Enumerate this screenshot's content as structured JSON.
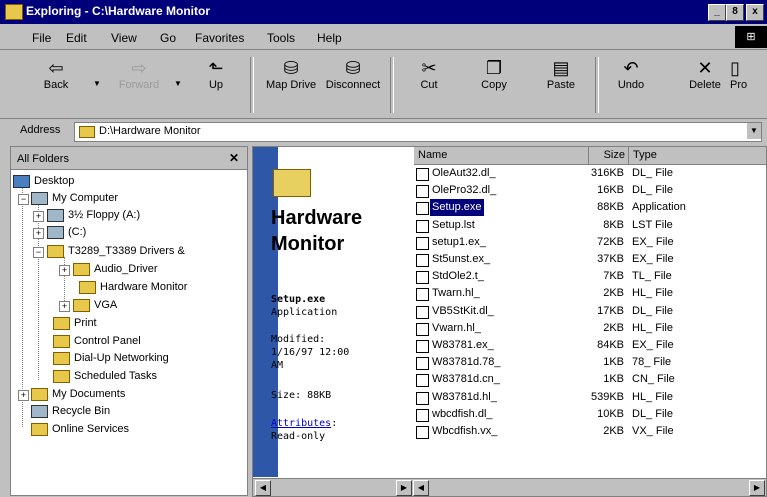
{
  "window": {
    "title": "Exploring - C:\\Hardware Monitor",
    "controls": [
      "_",
      "8",
      "x"
    ]
  },
  "menu": [
    "File",
    "Edit",
    "View",
    "Go",
    "Favorites",
    "Tools",
    "Help"
  ],
  "toolbar": {
    "back": "Back",
    "forward": "Forward",
    "up": "Up",
    "map_drive": "Map Drive",
    "disconnect": "Disconnect",
    "cut": "Cut",
    "copy": "Copy",
    "paste": "Paste",
    "undo": "Undo",
    "delete": "Delete",
    "properties": "Pro"
  },
  "address": {
    "label": "Address",
    "value": "D:\\Hardware Monitor"
  },
  "folders": {
    "header": "All Folders",
    "close": "✕",
    "items": [
      {
        "label": "Desktop"
      },
      {
        "label": "My Computer"
      },
      {
        "label": "3½ Floppy (A:)"
      },
      {
        "label": "(C:)"
      },
      {
        "label": "T3289_T3389 Drivers &"
      },
      {
        "label": "Audio_Driver"
      },
      {
        "label": "Hardware Monitor"
      },
      {
        "label": "VGA"
      },
      {
        "label": "Print"
      },
      {
        "label": "Control Panel"
      },
      {
        "label": "Dial-Up Networking"
      },
      {
        "label": "Scheduled Tasks"
      },
      {
        "label": "My Documents"
      },
      {
        "label": "Recycle Bin"
      },
      {
        "label": "Online Services"
      }
    ]
  },
  "webview": {
    "title_line1": "Hardware",
    "title_line2": "Monitor",
    "selected_name": "Setup.exe",
    "selected_type": "Application",
    "modified_label": "Modified:",
    "modified_value": "1/16/97 12:00",
    "modified_ampm": "AM",
    "size_text": "Size: 88KB",
    "attributes_label": "Attributes",
    "attributes_value": "Read-only"
  },
  "list": {
    "columns": [
      "Name",
      "Size",
      "Type"
    ],
    "rows": [
      {
        "name": "OleAut32.dl_",
        "size": "316KB",
        "type": "DL_ File"
      },
      {
        "name": "OlePro32.dl_",
        "size": "16KB",
        "type": "DL_ File"
      },
      {
        "name": "Setup.exe",
        "size": "88KB",
        "type": "Application"
      },
      {
        "name": "Setup.lst",
        "size": "8KB",
        "type": "LST File"
      },
      {
        "name": "setup1.ex_",
        "size": "72KB",
        "type": "EX_ File"
      },
      {
        "name": "St5unst.ex_",
        "size": "37KB",
        "type": "EX_ File"
      },
      {
        "name": "StdOle2.t_",
        "size": "7KB",
        "type": "TL_ File"
      },
      {
        "name": "Twarn.hl_",
        "size": "2KB",
        "type": "HL_ File"
      },
      {
        "name": "VB5StKit.dl_",
        "size": "17KB",
        "type": "DL_ File"
      },
      {
        "name": "Vwarn.hl_",
        "size": "2KB",
        "type": "HL_ File"
      },
      {
        "name": "W83781.ex_",
        "size": "84KB",
        "type": "EX_ File"
      },
      {
        "name": "W83781d.78_",
        "size": "1KB",
        "type": "78_ File"
      },
      {
        "name": "W83781d.cn_",
        "size": "1KB",
        "type": "CN_ File"
      },
      {
        "name": "W83781d.hl_",
        "size": "539KB",
        "type": "HL_ File"
      },
      {
        "name": "wbcdfish.dl_",
        "size": "10KB",
        "type": "DL_ File"
      },
      {
        "name": "Wbcdfish.vx_",
        "size": "2KB",
        "type": "VX_ File"
      }
    ],
    "selected_index": 2
  }
}
